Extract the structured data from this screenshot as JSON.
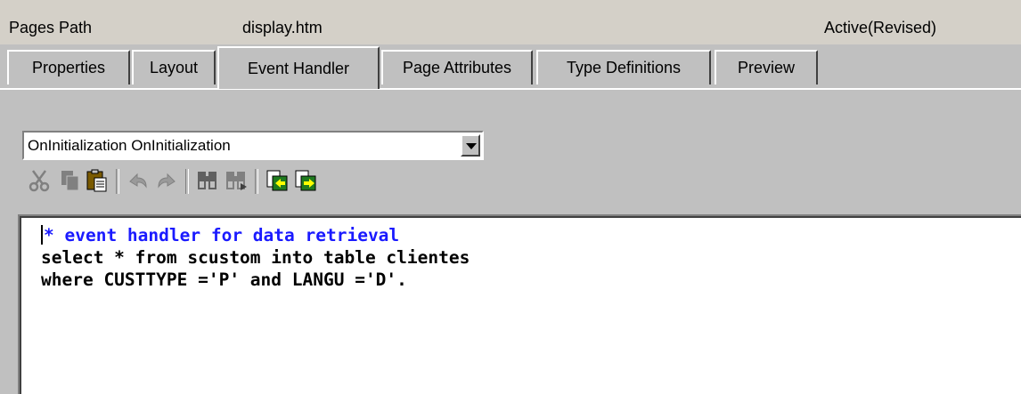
{
  "header": {
    "label": "Pages Path",
    "page_name": "display.htm",
    "status": "Active(Revised)"
  },
  "tabs": [
    {
      "label": "Properties",
      "active": false
    },
    {
      "label": "Layout",
      "active": false
    },
    {
      "label": "Event Handler",
      "active": true
    },
    {
      "label": "Page Attributes",
      "active": false
    },
    {
      "label": "Type Definitions",
      "active": false
    },
    {
      "label": "Preview",
      "active": false
    }
  ],
  "event_select": {
    "value": "OnInitialization OnInitialization"
  },
  "toolbar": {
    "icons": [
      "cut-icon",
      "copy-icon",
      "paste-icon",
      "undo-icon",
      "redo-icon",
      "find-icon",
      "find-next-icon",
      "import-icon",
      "export-icon"
    ]
  },
  "editor": {
    "lines": [
      "* event handler for data retrieval",
      "select * from scustom into table clientes",
      "where CUSTTYPE ='P' and LANGU ='D'."
    ],
    "comment_color": "#1a1aff"
  }
}
